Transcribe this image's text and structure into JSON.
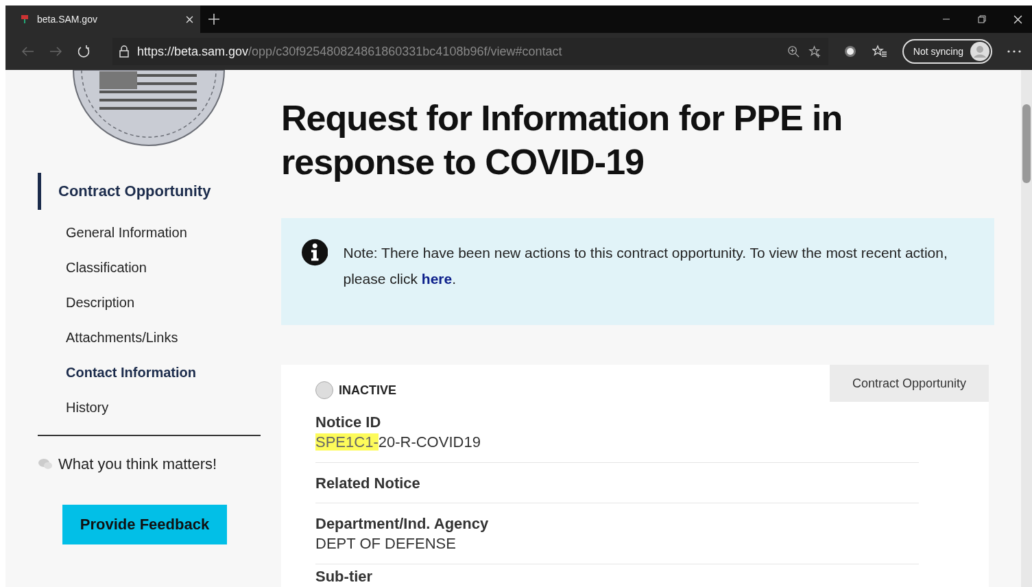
{
  "browser": {
    "tab_title": "beta.SAM.gov",
    "url": {
      "scheme": "https://",
      "host": "beta.sam.gov",
      "path": "/opp/c30f925480824861860331bc4108b96f/view#contact"
    },
    "profile_label": "Not syncing"
  },
  "sidebar": {
    "items": [
      {
        "kind": "heading",
        "label": "Contract Opportunity"
      },
      {
        "kind": "link",
        "label": "General Information",
        "selected": false
      },
      {
        "kind": "link",
        "label": "Classification",
        "selected": false
      },
      {
        "kind": "link",
        "label": "Description",
        "selected": false
      },
      {
        "kind": "link",
        "label": "Attachments/Links",
        "selected": false
      },
      {
        "kind": "link",
        "label": "Contact Information",
        "selected": true
      },
      {
        "kind": "link",
        "label": "History",
        "selected": false
      }
    ],
    "feedback_text": "What you think matters!",
    "feedback_button": "Provide Feedback"
  },
  "title": "Request for Information for PPE in response to COVID-19",
  "alert": {
    "text": "Note: There have been new actions to this contract opportunity. To view the most recent action, please click ",
    "link": "here",
    "after": "."
  },
  "card": {
    "status": "INACTIVE",
    "type_tab": "Contract Opportunity",
    "fields": [
      {
        "label": "Notice ID",
        "value": [
          {
            "text": "SPE1C1-",
            "highlighted": true
          },
          {
            "text": "20-R-COVID19",
            "highlighted": false
          }
        ]
      },
      {
        "label": "Related Notice"
      },
      {
        "label": "Department/Ind. Agency",
        "value": [
          {
            "text": "DEPT OF DEFENSE",
            "highlighted": false
          }
        ]
      },
      {
        "label": "Sub-tier"
      }
    ]
  }
}
